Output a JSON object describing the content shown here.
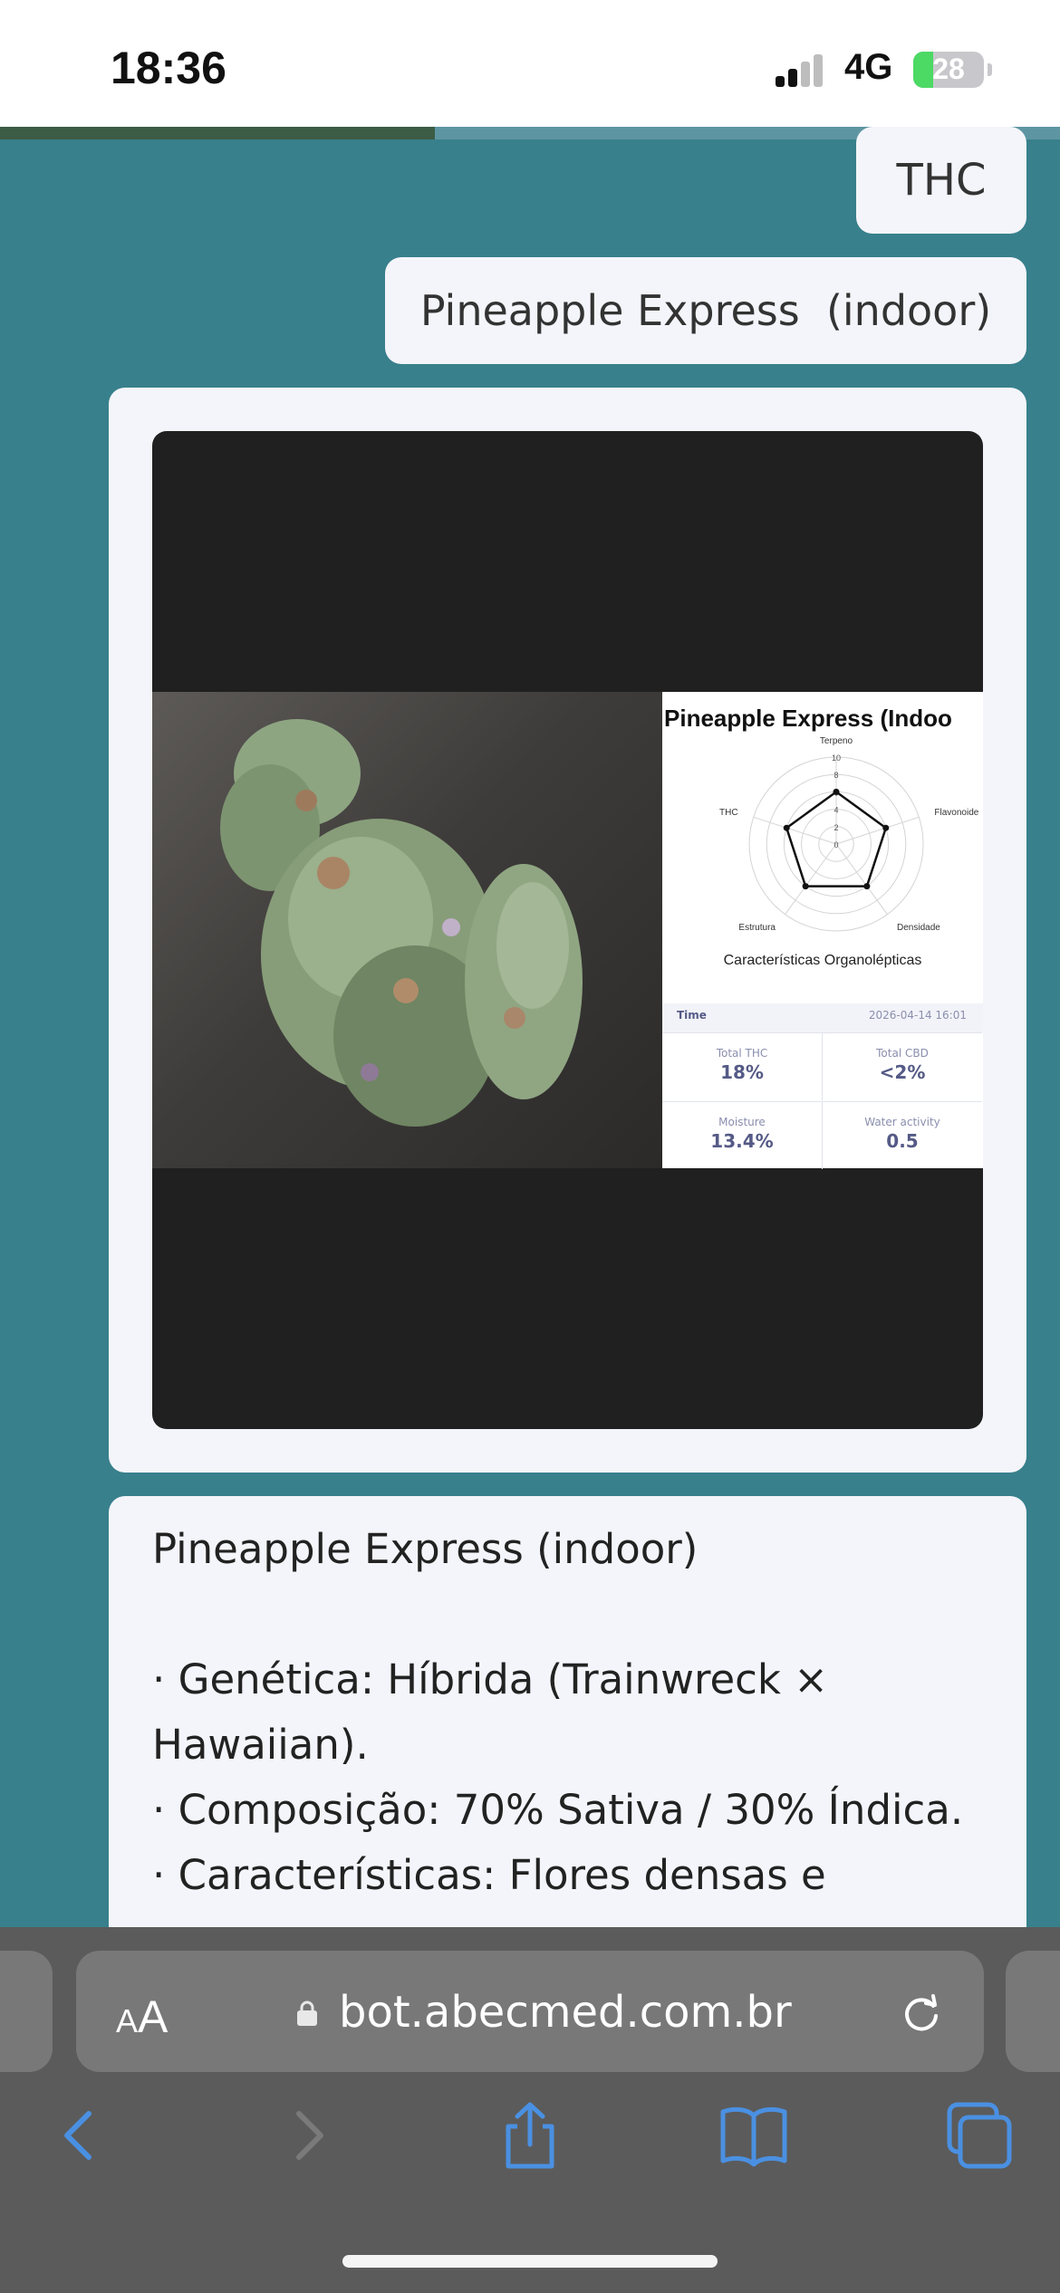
{
  "status_bar": {
    "time": "18:36",
    "network": "4G",
    "battery": "28",
    "battery_level": 0.28,
    "signal_bars_active": 2,
    "signal_bars_total": 4
  },
  "page_progress": 0.41,
  "messages": {
    "user_1": "THC",
    "user_2": "Pineapple Express  (indoor)"
  },
  "result_image": {
    "chart_title": "Pineapple Express (Indoo",
    "chart_subtitle": "Características Organolépticas",
    "time_label": "Time",
    "time_value": "2026-04-14 16:01",
    "stats": [
      {
        "label": "Total THC",
        "value": "18%"
      },
      {
        "label": "Total CBD",
        "value": "<2%"
      },
      {
        "label": "Moisture",
        "value": "13.4%"
      },
      {
        "label": "Water activity",
        "value": "0.5"
      }
    ],
    "chart_data": {
      "type": "radar",
      "title": "Pineapple Express (Indoo",
      "subtitle": "Características Organolépticas",
      "axes": [
        "Terpeno",
        "Flavonoide",
        "Densidade",
        "Estrutura",
        "THC"
      ],
      "values": [
        6,
        6,
        6,
        6,
        6
      ],
      "range": [
        0,
        10
      ],
      "ticks": [
        "0",
        "2",
        "4",
        "6",
        "8",
        "10"
      ]
    }
  },
  "description": {
    "title": "Pineapple Express (indoor)",
    "lines": [
      "· Genética: Híbrida (Trainwreck ×",
      "Hawaiian).",
      "· Composição: 70% Sativa / 30% Índica.",
      "· Características: Flores densas e"
    ]
  },
  "browser": {
    "aa_label_small": "A",
    "aa_label_large": "A",
    "url": "bot.abecmed.com.br"
  },
  "icons": {
    "back": "chevron-left-icon",
    "forward": "chevron-right-icon",
    "share": "share-icon",
    "bookmarks": "book-icon",
    "tabs": "tabs-icon",
    "lock": "lock-icon",
    "reload": "reload-icon"
  },
  "colors": {
    "chat_background": "#38808c",
    "bubble": "#f4f5fa",
    "progress_fill": "#3d5c46",
    "browser_bar": "#5b5b5b",
    "accent_blue": "#4a90e2",
    "battery_green": "#4cd964"
  }
}
